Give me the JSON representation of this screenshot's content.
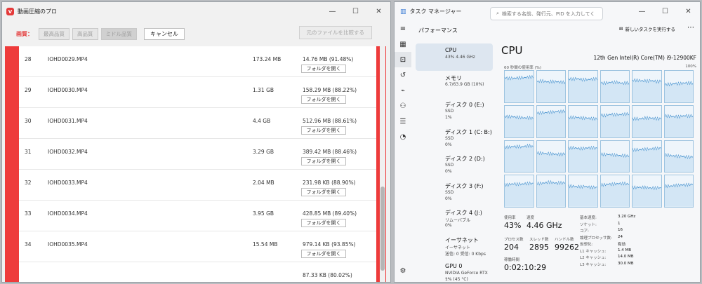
{
  "left_window": {
    "title": "動画圧縮のプロ",
    "logo_letter": "V",
    "toolbar": {
      "label": "画質：",
      "buttons": [
        "最高品質",
        "高品質",
        "ミドル品質"
      ],
      "cancel": "キャンセル",
      "open_file": "元のファイルを比較する"
    },
    "rows": [
      {
        "num": "28",
        "name": "IOHD0029.MP4",
        "size": "173.24 MB",
        "result": "14.76 MB (91.48%)",
        "btn": "フォルダを開く"
      },
      {
        "num": "29",
        "name": "IOHD0030.MP4",
        "size": "1.31 GB",
        "result": "158.29 MB (88.22%)",
        "btn": "フォルダを開く"
      },
      {
        "num": "30",
        "name": "IOHD0031.MP4",
        "size": "4.4 GB",
        "result": "512.96 MB (88.61%)",
        "btn": "フォルダを開く"
      },
      {
        "num": "31",
        "name": "IOHD0032.MP4",
        "size": "3.29 GB",
        "result": "389.42 MB (88.46%)",
        "btn": "フォルダを開く"
      },
      {
        "num": "32",
        "name": "IOHD0033.MP4",
        "size": "2.04 MB",
        "result": "231.98 KB (88.90%)",
        "btn": "フォルダを開く"
      },
      {
        "num": "33",
        "name": "IOHD0034.MP4",
        "size": "3.95 GB",
        "result": "428.85 MB (89.40%)",
        "btn": "フォルダを開く"
      },
      {
        "num": "34",
        "name": "IOHD0035.MP4",
        "size": "15.54 MB",
        "result": "979.14 KB (93.85%)",
        "btn": "フォルダを開く"
      },
      {
        "num": "",
        "name": "",
        "size": "",
        "result": "87.33 KB (80.02%)",
        "btn": ""
      }
    ]
  },
  "right_window": {
    "title": "タスク マネージャー",
    "search_placeholder": "検索する名前、発行元、PID を入力してく",
    "section": "パフォーマンス",
    "new_task": "新しいタスクを実行する",
    "items": [
      {
        "title": "CPU",
        "sub1": "43% 4.46 GHz",
        "sub2": "",
        "sub3": ""
      },
      {
        "title": "メモリ",
        "sub1": "6.7/63.9 GB (10%)",
        "sub2": "",
        "sub3": ""
      },
      {
        "title": "ディスク 0 (E:)",
        "sub1": "SSD",
        "sub2": "1%",
        "sub3": ""
      },
      {
        "title": "ディスク 1 (C: B:)",
        "sub1": "SSD",
        "sub2": "0%",
        "sub3": ""
      },
      {
        "title": "ディスク 2 (D:)",
        "sub1": "SSD",
        "sub2": "0%",
        "sub3": ""
      },
      {
        "title": "ディスク 3 (F:)",
        "sub1": "SSD",
        "sub2": "0%",
        "sub3": ""
      },
      {
        "title": "ディスク 4 (J:)",
        "sub1": "リムーバブル",
        "sub2": "0%",
        "sub3": ""
      },
      {
        "title": "イーサネット",
        "sub1": "イーサネット",
        "sub2": "送信: 0 受信: 0 Kbps",
        "sub3": ""
      },
      {
        "title": "GPU 0",
        "sub1": "NVIDIA GeForce RTX ...",
        "sub2": "1% (45 °C)",
        "sub3": ""
      }
    ],
    "cpu": {
      "title": "CPU",
      "model": "12th Gen Intel(R) Core(TM) i9-12900KF",
      "graph_label": "60 秒間の使用率 (%)",
      "graph_max": "100%",
      "stats": {
        "usage_label": "使用率",
        "usage": "43%",
        "speed_label": "速度",
        "speed": "4.46 GHz",
        "proc_label": "プロセス数",
        "proc": "204",
        "thread_label": "スレッド数",
        "thread": "2895",
        "handle_label": "ハンドル数",
        "handle": "99262",
        "uptime_label": "稼働時間",
        "uptime": "0:02:10:29"
      },
      "specs": [
        {
          "k": "基本速度:",
          "v": "3.20 GHz"
        },
        {
          "k": "ソケット:",
          "v": "1"
        },
        {
          "k": "コア:",
          "v": "16"
        },
        {
          "k": "論理プロセッサ数:",
          "v": "24"
        },
        {
          "k": "仮想化:",
          "v": "有効"
        },
        {
          "k": "L1 キャッシュ:",
          "v": "1.4 MB"
        },
        {
          "k": "L2 キャッシュ:",
          "v": "14.0 MB"
        },
        {
          "k": "L3 キャッシュ:",
          "v": "30.0 MB"
        }
      ]
    }
  }
}
